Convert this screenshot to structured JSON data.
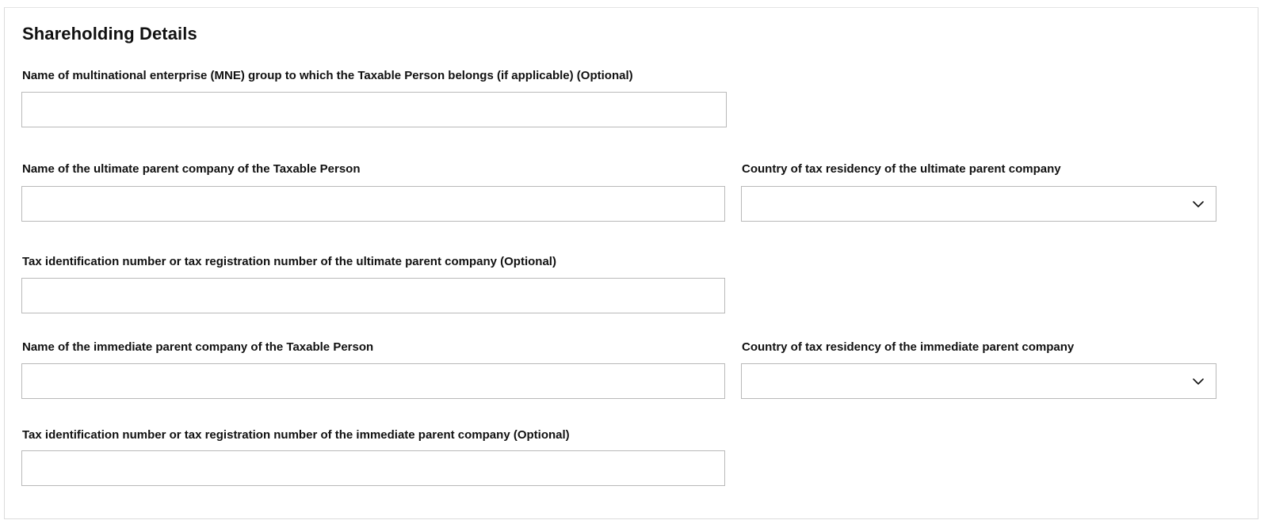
{
  "section": {
    "title": "Shareholding Details"
  },
  "fields": {
    "mne_group": {
      "label": "Name of multinational enterprise (MNE) group to which the Taxable Person belongs (if applicable) (Optional)",
      "value": ""
    },
    "ultimate_parent_name": {
      "label": "Name of the ultimate parent company of the Taxable Person",
      "value": ""
    },
    "ultimate_parent_country": {
      "label": "Country of tax residency of the ultimate parent company",
      "value": "",
      "icon": "chevron-down-icon"
    },
    "ultimate_parent_tin": {
      "label": "Tax identification number or tax registration number of the ultimate parent company  (Optional)",
      "value": ""
    },
    "immediate_parent_name": {
      "label": "Name of the immediate parent company of the Taxable Person",
      "value": ""
    },
    "immediate_parent_country": {
      "label": "Country of tax residency of the immediate parent company",
      "value": "",
      "icon": "chevron-down-icon"
    },
    "immediate_parent_tin": {
      "label": "Tax identification number or tax registration number of the immediate parent company  (Optional)",
      "value": ""
    }
  },
  "colors": {
    "border": "#b9b9b9",
    "panel_border": "#dcdcdc",
    "text": "#111111",
    "background": "#ffffff"
  }
}
